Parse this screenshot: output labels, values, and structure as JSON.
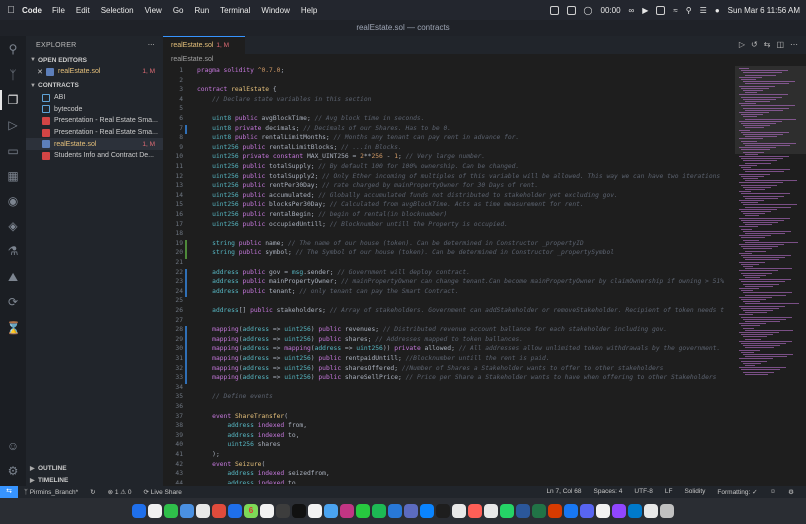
{
  "menubar": {
    "app": "Code",
    "items": [
      "File",
      "Edit",
      "Selection",
      "View",
      "Go",
      "Run",
      "Terminal",
      "Window",
      "Help"
    ],
    "timer": "00:00",
    "datetime": "Sun Mar 6  11:56 AM"
  },
  "window": {
    "title": "realEstate.sol — contracts"
  },
  "sidebar": {
    "header": "EXPLORER",
    "open_editors": {
      "title": "OPEN EDITORS",
      "items": [
        {
          "label": "realEstate.sol",
          "status": "1, M"
        }
      ]
    },
    "contracts": {
      "title": "CONTRACTS",
      "items": [
        {
          "label": "ABI",
          "icon": "json-icon"
        },
        {
          "label": "bytecode",
          "icon": "json-icon"
        },
        {
          "label": "Presentation - Real Estate Sma...",
          "icon": "pdf-icon"
        },
        {
          "label": "Presentation - Real Estate Sma...",
          "icon": "pdf-icon"
        },
        {
          "label": "realEstate.sol",
          "icon": "solidity-file-icon",
          "status": "1, M"
        },
        {
          "label": "Students Info and Contract De...",
          "icon": "pdf-icon"
        }
      ]
    },
    "outline": "OUTLINE",
    "timeline": "TIMELINE"
  },
  "editor": {
    "tab": {
      "label": "realEstate.sol",
      "status": "1, M"
    },
    "breadcrumb": "realEstate.sol",
    "lines": [
      {
        "n": "1",
        "html": "<span class='kw'>pragma</span> <span class='kw'>solidity</span> <span class='nu'>^0.7.0</span>;",
        "g": ""
      },
      {
        "n": "2",
        "html": "",
        "g": ""
      },
      {
        "n": "3",
        "html": "<span class='kw'>contract</span> <span class='fn'>realEstate</span> {",
        "g": ""
      },
      {
        "n": "4",
        "html": "    <span class='cm'>// Declare state variables in this section</span>",
        "g": ""
      },
      {
        "n": "5",
        "html": "",
        "g": ""
      },
      {
        "n": "6",
        "html": "    <span class='ty'>uint8</span> <span class='kw'>public</span> avgBlockTime; <span class='cm'>// Avg block time in seconds.</span>",
        "g": ""
      },
      {
        "n": "7",
        "html": "    <span class='ty'>uint8</span> <span class='kw'>private</span> decimals; <span class='cm'>// Decimals of our Shares. Has to be 0.</span>",
        "g": "m"
      },
      {
        "n": "8",
        "html": "    <span class='ty'>uint8</span> <span class='kw'>public</span> rentalLimitMonths; <span class='cm'>// Months any tenant can pay rent in advance for.</span>",
        "g": ""
      },
      {
        "n": "9",
        "html": "    <span class='ty'>uint256</span> <span class='kw'>public</span> rentalLimitBlocks; <span class='cm'>// ...in Blocks.</span>",
        "g": ""
      },
      {
        "n": "10",
        "html": "    <span class='ty'>uint256</span> <span class='kw'>private</span> <span class='kw'>constant</span> MAX_UINT256 = <span class='nu'>2</span>**<span class='nu'>256</span> - <span class='nu'>1</span>; <span class='cm'>// Very large number.</span>",
        "g": ""
      },
      {
        "n": "11",
        "html": "    <span class='ty'>uint256</span> <span class='kw'>public</span> totalSupply; <span class='cm'>// By default 100 for 100% ownership. Can be changed.</span>",
        "g": ""
      },
      {
        "n": "12",
        "html": "    <span class='ty'>uint256</span> <span class='kw'>public</span> totalSupply2; <span class='cm'>// Only Ether incoming of multiples of this variable will be allowed. This way we can have two iterations</span>",
        "g": ""
      },
      {
        "n": "13",
        "html": "    <span class='ty'>uint256</span> <span class='kw'>public</span> rentPer30Day; <span class='cm'>// rate charged by mainPropertyOwner for 30 Days of rent.</span>",
        "g": ""
      },
      {
        "n": "14",
        "html": "    <span class='ty'>uint256</span> <span class='kw'>public</span> accumulated; <span class='cm'>// Globally accumulated funds not distributed to stakeholder yet excluding gov.</span>",
        "g": ""
      },
      {
        "n": "15",
        "html": "    <span class='ty'>uint256</span> <span class='kw'>public</span> blocksPer30Day; <span class='cm'>// Calculated from avgBlockTime. Acts as time measurement for rent.</span>",
        "g": ""
      },
      {
        "n": "16",
        "html": "    <span class='ty'>uint256</span> <span class='kw'>public</span> rentalBegin; <span class='cm'>// begin of rental(in blocknumber)</span>",
        "g": ""
      },
      {
        "n": "17",
        "html": "    <span class='ty'>uint256</span> <span class='kw'>public</span> occupiedUntill; <span class='cm'>// Blocknumber untill the Property is occupied.</span>",
        "g": ""
      },
      {
        "n": "18",
        "html": "",
        "g": ""
      },
      {
        "n": "19",
        "html": "    <span class='ty'>string</span> <span class='kw'>public</span> name; <span class='cm'>// The name of our house (token). Can be determined in Constructor _propertyID</span>",
        "g": "a"
      },
      {
        "n": "20",
        "html": "    <span class='ty'>string</span> <span class='kw'>public</span> symbol; <span class='cm'>// The Symbol of our house (token). Can be determined in Constructor _propertySymbol</span>",
        "g": "a"
      },
      {
        "n": "21",
        "html": "",
        "g": ""
      },
      {
        "n": "22",
        "html": "    <span class='ty'>address</span> <span class='kw'>public</span> gov = <span class='ty'>msg</span>.sender; <span class='cm'>// Government will deploy contract.</span>",
        "g": "m"
      },
      {
        "n": "23",
        "html": "    <span class='ty'>address</span> <span class='kw'>public</span> mainPropertyOwner; <span class='cm'>// mainPropertyOwner can change tenant.Can become mainPropertyOwner by claimOwnership if owning > 51%</span>",
        "g": "m"
      },
      {
        "n": "24",
        "html": "    <span class='ty'>address</span> <span class='kw'>public</span> tenant; <span class='cm'>// only tenant can pay the Smart Contract.</span>",
        "g": "m"
      },
      {
        "n": "25",
        "html": "",
        "g": ""
      },
      {
        "n": "26",
        "html": "    <span class='ty'>address</span>[] <span class='kw'>public</span> stakeholders; <span class='cm'>// Array of stakeholders. Government can addStakeholder or removeStakeholder. Recipient of token needs t</span>",
        "g": ""
      },
      {
        "n": "27",
        "html": "",
        "g": ""
      },
      {
        "n": "28",
        "html": "    <span class='kw'>mapping</span>(<span class='ty'>address</span> => <span class='ty'>uint256</span>) <span class='kw'>public</span> revenues; <span class='cm'>// Distributed revenue account ballance for each stakeholder including gov.</span>",
        "g": "m"
      },
      {
        "n": "29",
        "html": "    <span class='kw'>mapping</span>(<span class='ty'>address</span> => <span class='ty'>uint256</span>) <span class='kw'>public</span> shares; <span class='cm'>// Addresses mapped to token ballances.</span>",
        "g": "m"
      },
      {
        "n": "30",
        "html": "    <span class='kw'>mapping</span>(<span class='ty'>address</span> => <span class='kw'>mapping</span>(<span class='ty'>address</span> => <span class='ty'>uint256</span>)) <span class='kw'>private</span> allowed; <span class='cm'>// All addresses allow unlimited token withdrawals by the government.</span>",
        "g": "m"
      },
      {
        "n": "31",
        "html": "    <span class='kw'>mapping</span>(<span class='ty'>address</span> => <span class='ty'>uint256</span>) <span class='kw'>public</span> rentpaidUntill; <span class='cm'>//Blocknumber untill the rent is paid.</span>",
        "g": "m"
      },
      {
        "n": "32",
        "html": "    <span class='kw'>mapping</span>(<span class='ty'>address</span> => <span class='ty'>uint256</span>) <span class='kw'>public</span> sharesOffered; <span class='cm'>//Number of Shares a Stakeholder wants to offer to other stakeholders</span>",
        "g": "m"
      },
      {
        "n": "33",
        "html": "    <span class='kw'>mapping</span>(<span class='ty'>address</span> => <span class='ty'>uint256</span>) <span class='kw'>public</span> shareSellPrice; <span class='cm'>// Price per Share a Stakeholder wants to have when offering to other Stakeholders</span>",
        "g": "m"
      },
      {
        "n": "34",
        "html": "",
        "g": ""
      },
      {
        "n": "35",
        "html": "    <span class='cm'>// Define events</span>",
        "g": ""
      },
      {
        "n": "36",
        "html": "",
        "g": ""
      },
      {
        "n": "37",
        "html": "    <span class='kw'>event</span> <span class='fn'>ShareTransfer</span>(",
        "g": ""
      },
      {
        "n": "38",
        "html": "        <span class='ty'>address</span> <span class='kw'>indexed</span> from,",
        "g": ""
      },
      {
        "n": "39",
        "html": "        <span class='ty'>address</span> <span class='kw'>indexed</span> to,",
        "g": ""
      },
      {
        "n": "40",
        "html": "        <span class='ty'>uint256</span> shares",
        "g": ""
      },
      {
        "n": "41",
        "html": "    );",
        "g": ""
      },
      {
        "n": "42",
        "html": "    <span class='kw'>event</span> <span class='fn'>Seizure</span>(",
        "g": ""
      },
      {
        "n": "43",
        "html": "        <span class='ty'>address</span> <span class='kw'>indexed</span> seizedfrom,",
        "g": ""
      },
      {
        "n": "44",
        "html": "        <span class='ty'>address</span> <span class='kw'>indexed</span> to,",
        "g": ""
      }
    ]
  },
  "statusbar": {
    "branch": "Pirmins_Branch*",
    "problems": "⊗ 1 ⚠ 0",
    "live_share": "Live Share",
    "position": "Ln 7, Col 68",
    "spaces": "Spaces: 4",
    "encoding": "UTF-8",
    "eol": "LF",
    "language": "Solidity",
    "formatting": "Formatting: ✓"
  },
  "dock": {
    "calendar_day": "6",
    "colors": [
      "#1f6feb",
      "#f0f0f0",
      "#2fbf4a",
      "#4a90e2",
      "#e8e8e8",
      "#e04b3c",
      "#1f6feb",
      "#7ed957",
      "#f2f2f2",
      "#3d3d3d",
      "#111111",
      "#f2f2f2",
      "#4aa3f0",
      "#c13584",
      "#27c93f",
      "#1db954",
      "#2878d8",
      "#5c6bc0",
      "#0a84ff",
      "#1e1e1e",
      "#e8e8e8",
      "#ff5f57",
      "#e8e8e8",
      "#25d366",
      "#2b579a",
      "#217346",
      "#d83b01",
      "#1877f2",
      "#5865f2",
      "#f2f2f2",
      "#9146ff",
      "#007acc",
      "#e8e8e8",
      "#c0c0c0"
    ]
  }
}
